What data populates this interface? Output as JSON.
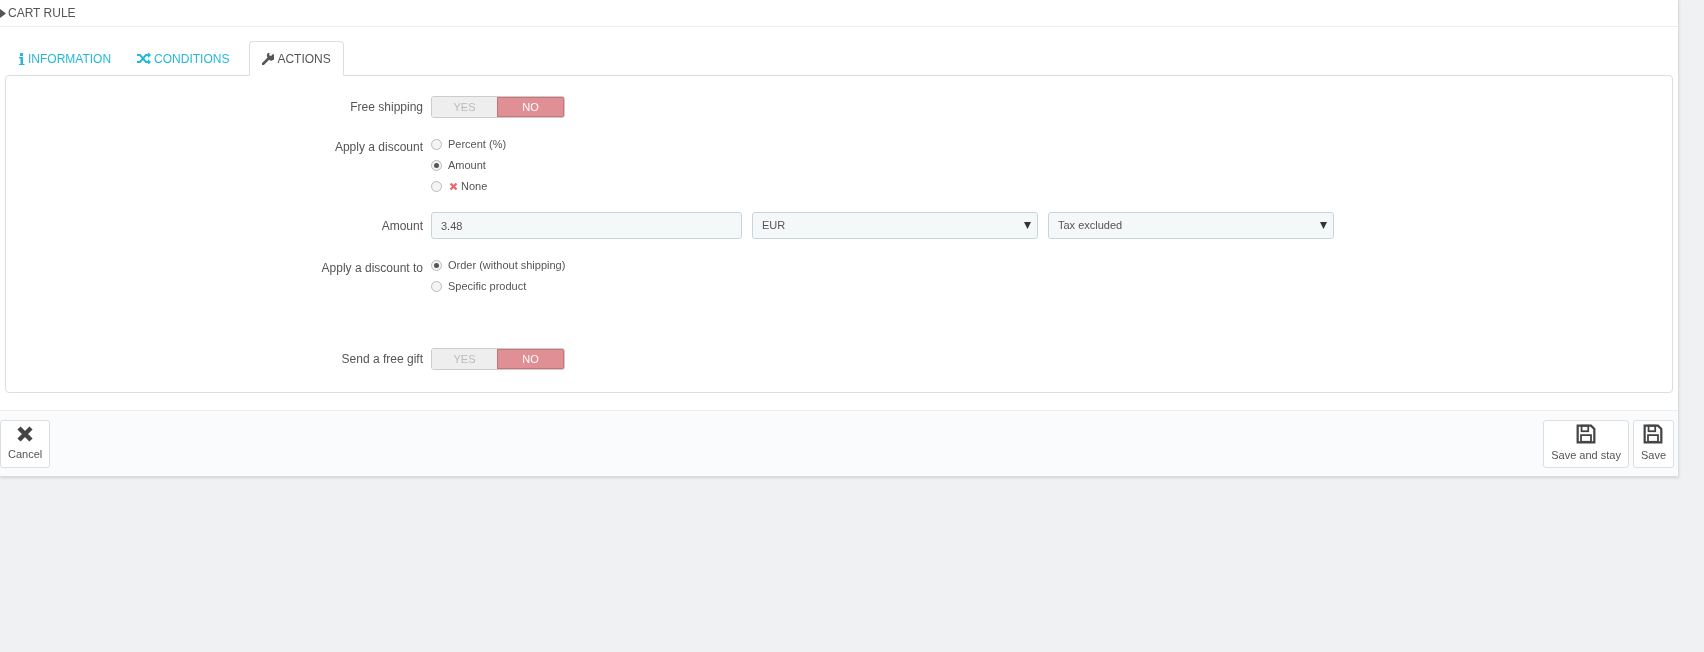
{
  "header": {
    "title": "CART RULE"
  },
  "tabs": [
    {
      "label": "INFORMATION",
      "selected": false
    },
    {
      "label": "CONDITIONS",
      "selected": false
    },
    {
      "label": "ACTIONS",
      "selected": true
    }
  ],
  "form": {
    "rows": [
      {
        "kind": "switch",
        "label": "Free shipping",
        "options": [
          {
            "label": "YES",
            "selected": false
          },
          {
            "label": "NO",
            "selected": true
          }
        ]
      },
      {
        "kind": "radio",
        "label": "Apply a discount",
        "options": [
          {
            "label": "Percent (%)",
            "selected": false
          },
          {
            "label": "Amount",
            "selected": true
          },
          {
            "label": "None",
            "selected": false,
            "kind": "none"
          }
        ]
      },
      {
        "kind": "fields",
        "label": "Amount",
        "value": "3.48",
        "selects": [
          "EUR",
          "Tax excluded"
        ]
      },
      {
        "kind": "radio",
        "label": "Apply a discount to",
        "options": [
          {
            "label": "Order (without shipping)",
            "selected": true
          },
          {
            "label": "Specific product",
            "selected": false
          }
        ]
      },
      {
        "kind": "switch",
        "label": "Send a free gift",
        "options": [
          {
            "label": "YES",
            "selected": false
          },
          {
            "label": "NO",
            "selected": true
          }
        ]
      }
    ]
  },
  "footer": {
    "buttons": [
      {
        "label": "Cancel",
        "kind": "cancel"
      },
      {
        "label": "Save and stay",
        "kind": "save"
      },
      {
        "label": "Save",
        "kind": "save"
      }
    ]
  }
}
